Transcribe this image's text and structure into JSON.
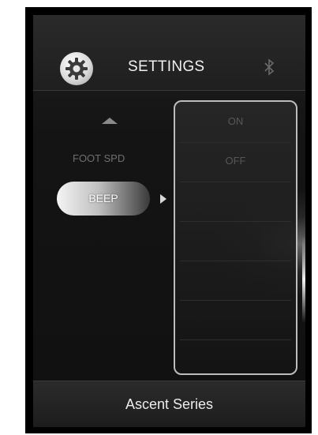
{
  "header": {
    "title": "SETTINGS",
    "settings_icon": "gear-icon",
    "status_icon": "bluetooth-icon"
  },
  "menu": {
    "scroll_up_icon": "caret-up-icon",
    "items": [
      {
        "label": "FOOT SPD",
        "selected": false
      },
      {
        "label": "BEEP",
        "selected": true
      }
    ],
    "selected_indicator_icon": "caret-right-icon"
  },
  "options": {
    "rows": [
      "ON",
      "OFF",
      "",
      "",
      "",
      "",
      ""
    ]
  },
  "footer": {
    "text": "Ascent Series"
  },
  "colors": {
    "background": "#141414",
    "accent_outline": "#bcbcbc",
    "dim_text": "#6f6f6f",
    "bright_text": "#f0f0f0"
  }
}
